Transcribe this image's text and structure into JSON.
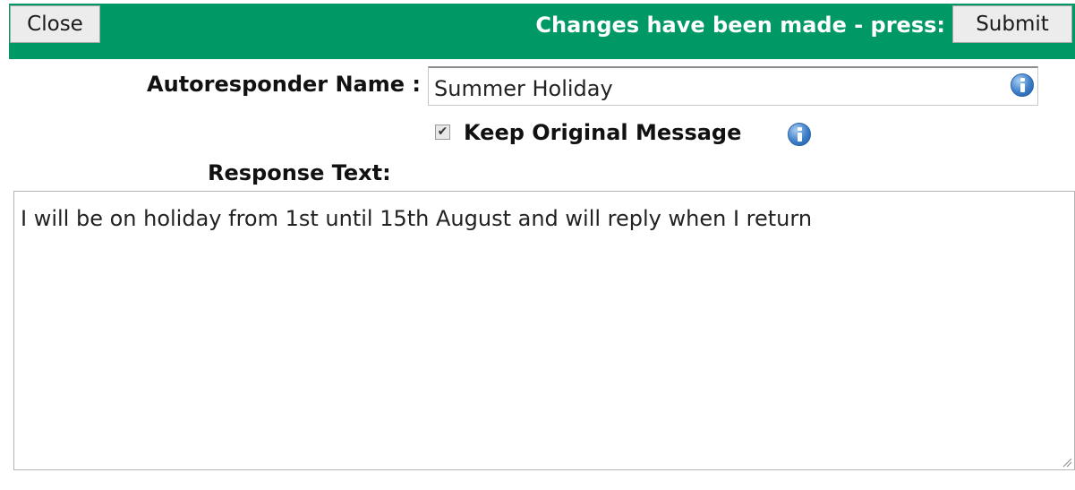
{
  "toolbar": {
    "close_label": "Close",
    "status_text": "Changes have been made - press:",
    "submit_label": "Submit",
    "bar_color": "#009966"
  },
  "form": {
    "name_label": "Autoresponder Name :",
    "name_value": "Summer Holiday",
    "keep_original_label": "Keep Original Message",
    "keep_original_checked": true,
    "response_label": "Response Text:",
    "response_value": "I will be on holiday from 1st until 15th August and will reply when I return"
  },
  "icons": {
    "info": "info-icon",
    "check": "checkmark"
  }
}
